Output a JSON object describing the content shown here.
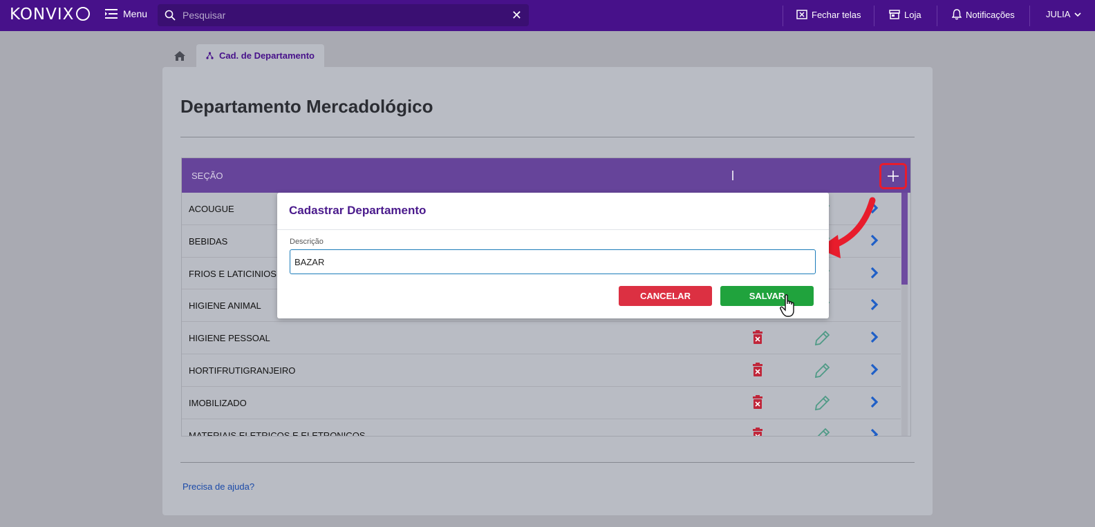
{
  "header": {
    "logo": "KONVIX",
    "menu_label": "Menu",
    "search_placeholder": "Pesquisar",
    "close_screens": "Fechar telas",
    "store": "Loja",
    "notifications": "Notificações",
    "user": "JULIA"
  },
  "tabs": {
    "active": "Cad. de Departamento"
  },
  "page": {
    "title": "Departamento Mercadológico",
    "help_link": "Precisa de ajuda?"
  },
  "table": {
    "column_header": "SEÇÃO",
    "rows": [
      {
        "name": "ACOUGUE"
      },
      {
        "name": "BEBIDAS"
      },
      {
        "name": "FRIOS E LATICINIOS"
      },
      {
        "name": "HIGIENE ANIMAL"
      },
      {
        "name": "HIGIENE PESSOAL"
      },
      {
        "name": "HORTIFRUTIGRANJEIRO"
      },
      {
        "name": "IMOBILIZADO"
      },
      {
        "name": "MATERIAIS ELETRICOS E ELETRONICOS"
      }
    ]
  },
  "modal": {
    "title": "Cadastrar Departamento",
    "field_label": "Descrição",
    "field_value": "BAZAR",
    "cancel_label": "CANCELAR",
    "save_label": "SALVAR"
  },
  "colors": {
    "brand": "#47118a",
    "table_header": "#66449a",
    "danger": "#dc3042",
    "success": "#20a33d",
    "edit": "#4f9a86",
    "forward": "#1f5fc7",
    "highlight": "#e81c2c"
  },
  "icons": [
    "menu-icon",
    "search-icon",
    "close-icon",
    "close-screens-icon",
    "store-icon",
    "bell-icon",
    "chevron-down-icon",
    "home-icon",
    "department-icon",
    "plus-icon",
    "trash-icon",
    "pencil-icon",
    "chevron-right-icon",
    "hand-cursor-icon",
    "red-arrow-icon"
  ]
}
